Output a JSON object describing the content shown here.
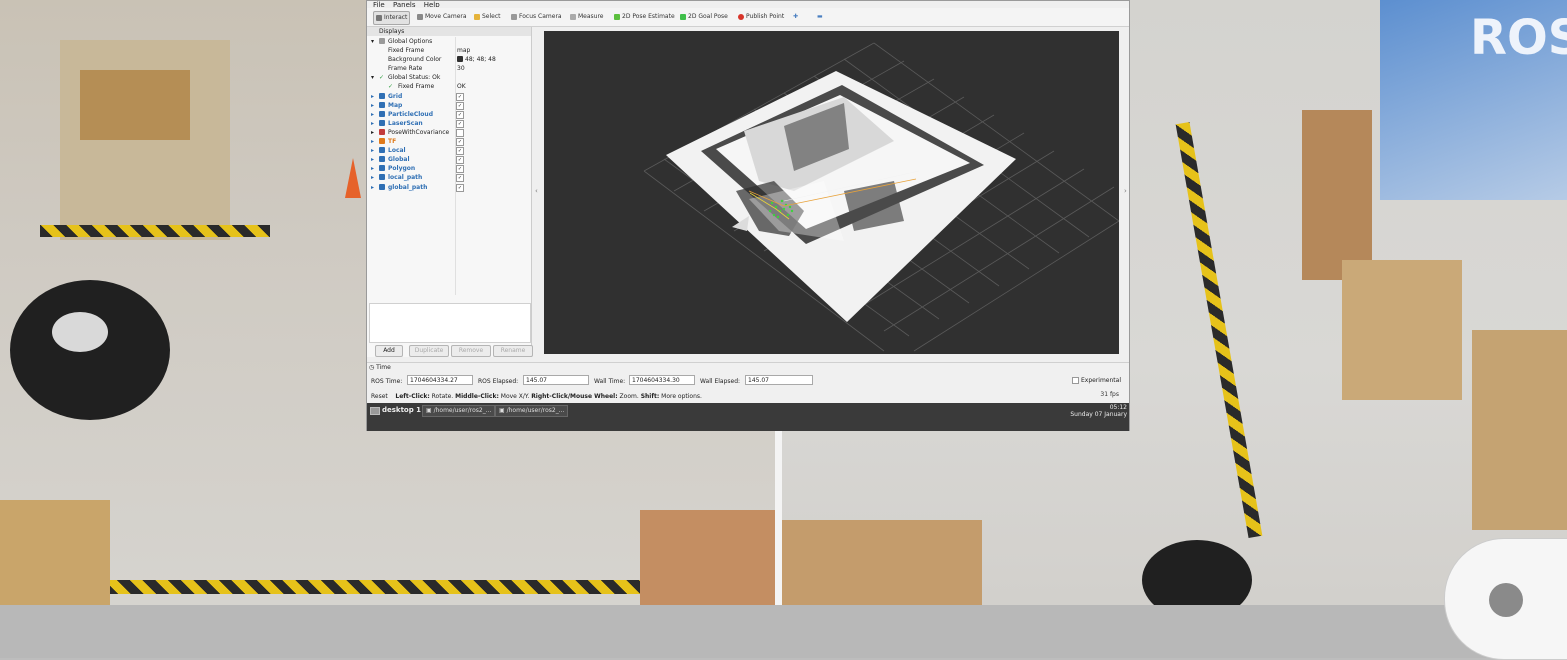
{
  "menubar": {
    "items": [
      "File",
      "Panels",
      "Help"
    ]
  },
  "toolbar": {
    "tools": [
      {
        "label": "Interact",
        "icon": "pointer-icon",
        "active": true
      },
      {
        "label": "Move Camera",
        "icon": "move-camera-icon"
      },
      {
        "label": "Select",
        "icon": "select-icon"
      },
      {
        "label": "Focus Camera",
        "icon": "focus-camera-icon"
      },
      {
        "label": "Measure",
        "icon": "ruler-icon"
      },
      {
        "label": "2D Pose Estimate",
        "icon": "pose-estimate-icon"
      },
      {
        "label": "2D Goal Pose",
        "icon": "goal-pose-icon"
      },
      {
        "label": "Publish Point",
        "icon": "publish-point-icon"
      }
    ],
    "extra_icons": [
      "plus-icon",
      "minus-icon"
    ]
  },
  "displays": {
    "title": "Displays",
    "global_options": {
      "label": "Global Options",
      "fixed_frame_label": "Fixed Frame",
      "fixed_frame_value": "map",
      "background_color_label": "Background Color",
      "background_color_value": "48; 48; 48",
      "frame_rate_label": "Frame Rate",
      "frame_rate_value": "30"
    },
    "global_status": {
      "label": "Global Status: Ok",
      "fixed_frame_label": "Fixed Frame",
      "fixed_frame_value": "OK"
    },
    "items": [
      {
        "label": "Grid",
        "checked": true,
        "color": "#2f6fb4"
      },
      {
        "label": "Map",
        "checked": true,
        "color": "#2f6fb4"
      },
      {
        "label": "ParticleCloud",
        "checked": true,
        "color": "#2f6fb4"
      },
      {
        "label": "LaserScan",
        "checked": true,
        "color": "#2f6fb4"
      },
      {
        "label": "PoseWithCovariance",
        "checked": false,
        "color": "#222222"
      },
      {
        "label": "TF",
        "checked": true,
        "color": "#e07a1a"
      },
      {
        "label": "Local",
        "checked": true,
        "color": "#2f6fb4"
      },
      {
        "label": "Global",
        "checked": true,
        "color": "#2f6fb4"
      },
      {
        "label": "Polygon",
        "checked": true,
        "color": "#2f6fb4"
      },
      {
        "label": "local_path",
        "checked": true,
        "color": "#2f6fb4"
      },
      {
        "label": "global_path",
        "checked": true,
        "color": "#2f6fb4"
      }
    ],
    "buttons": {
      "add": "Add",
      "duplicate": "Duplicate",
      "remove": "Remove",
      "rename": "Rename"
    }
  },
  "time": {
    "title": "Time",
    "ros_time_label": "ROS Time:",
    "ros_time": "1704604334.27",
    "ros_elapsed_label": "ROS Elapsed:",
    "ros_elapsed": "145.07",
    "wall_time_label": "Wall Time:",
    "wall_time": "1704604334.30",
    "wall_elapsed_label": "Wall Elapsed:",
    "wall_elapsed": "145.07",
    "experimental_label": "Experimental",
    "reset_label": "Reset",
    "hint_left_b": "Left-Click:",
    "hint_left": "Rotate.",
    "hint_middle_b": "Middle-Click:",
    "hint_middle": "Move X/Y.",
    "hint_right_b": "Right-Click/Mouse Wheel:",
    "hint_right": "Zoom.",
    "hint_shift_b": "Shift:",
    "hint_shift": "More options.",
    "fps": "31 fps"
  },
  "taskbar": {
    "desktop": "desktop 1",
    "tasks": [
      "/home/user/ros2_...",
      "/home/user/ros2_..."
    ],
    "clock_time": "05:12",
    "clock_date": "Sunday 07 January"
  },
  "camera_right": {
    "wall_sign": "ROS"
  },
  "colors": {
    "viewport_bg": "#303030",
    "accent": "#2f6fb4",
    "taskbar": "#3a3a3a"
  }
}
